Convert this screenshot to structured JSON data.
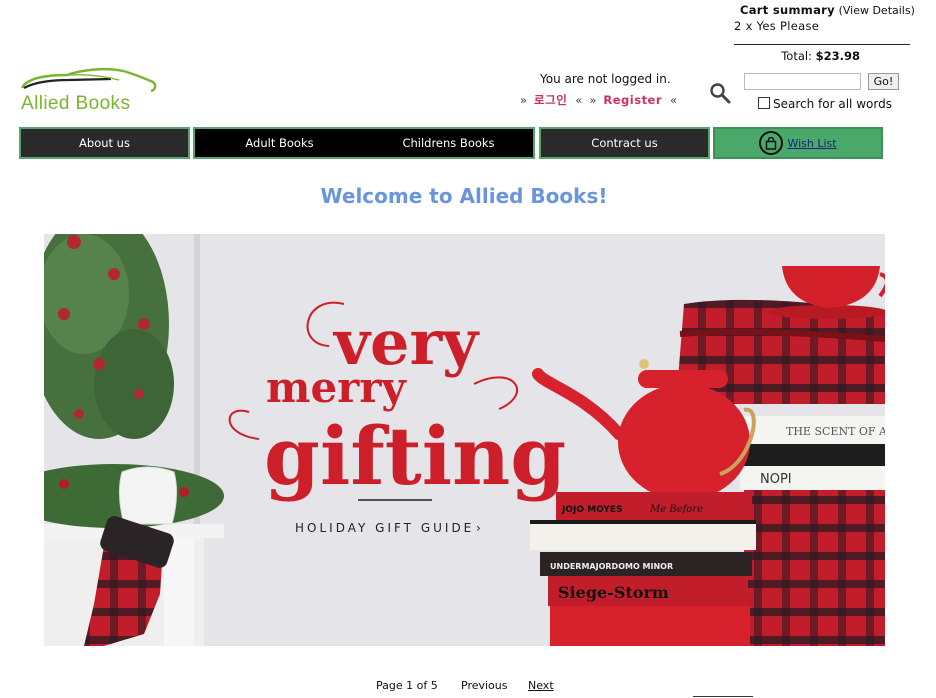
{
  "cart": {
    "title": "Cart summary",
    "view_details": "(View Details)",
    "item": "2 x Yes Please",
    "total_label": "Total:",
    "total_value": "$23.98"
  },
  "logo": {
    "text": "Allied Books"
  },
  "login": {
    "status": "You are not logged in.",
    "quote_open": "»",
    "korean_login": "로그인",
    "quote_close": "«",
    "register": "Register"
  },
  "search": {
    "placeholder": "",
    "go": "Go!",
    "all_words": "Search for all words"
  },
  "nav": {
    "about": "About us",
    "adult": "Adult Books",
    "childrens": "Childrens Books",
    "contract": "Contract us",
    "wishlist": "Wish List"
  },
  "page": {
    "welcome": "Welcome to Allied Books!"
  },
  "banner": {
    "line1": "very",
    "line2": "merry",
    "line3": "gifting",
    "guide": "HOLIDAY GIFT GUIDE",
    "book1": "JOJO MOYES",
    "book1b": "Me Before",
    "book2": "UNDERMAJORDOMO MINOR",
    "book3": "Siege-Storm",
    "book4": "THE SCENT OF A D",
    "book5": "NOPI"
  },
  "pager": {
    "info": "Page 1 of 5",
    "previous": "Previous",
    "next": "Next"
  },
  "colors": {
    "brand_green": "#7ab52e",
    "title_blue": "#6a95dc",
    "link_pink": "#d0305a",
    "nav_dark": "#2a2a2a",
    "wish_green": "#4aa86a",
    "banner_red": "#cc1f2a"
  }
}
